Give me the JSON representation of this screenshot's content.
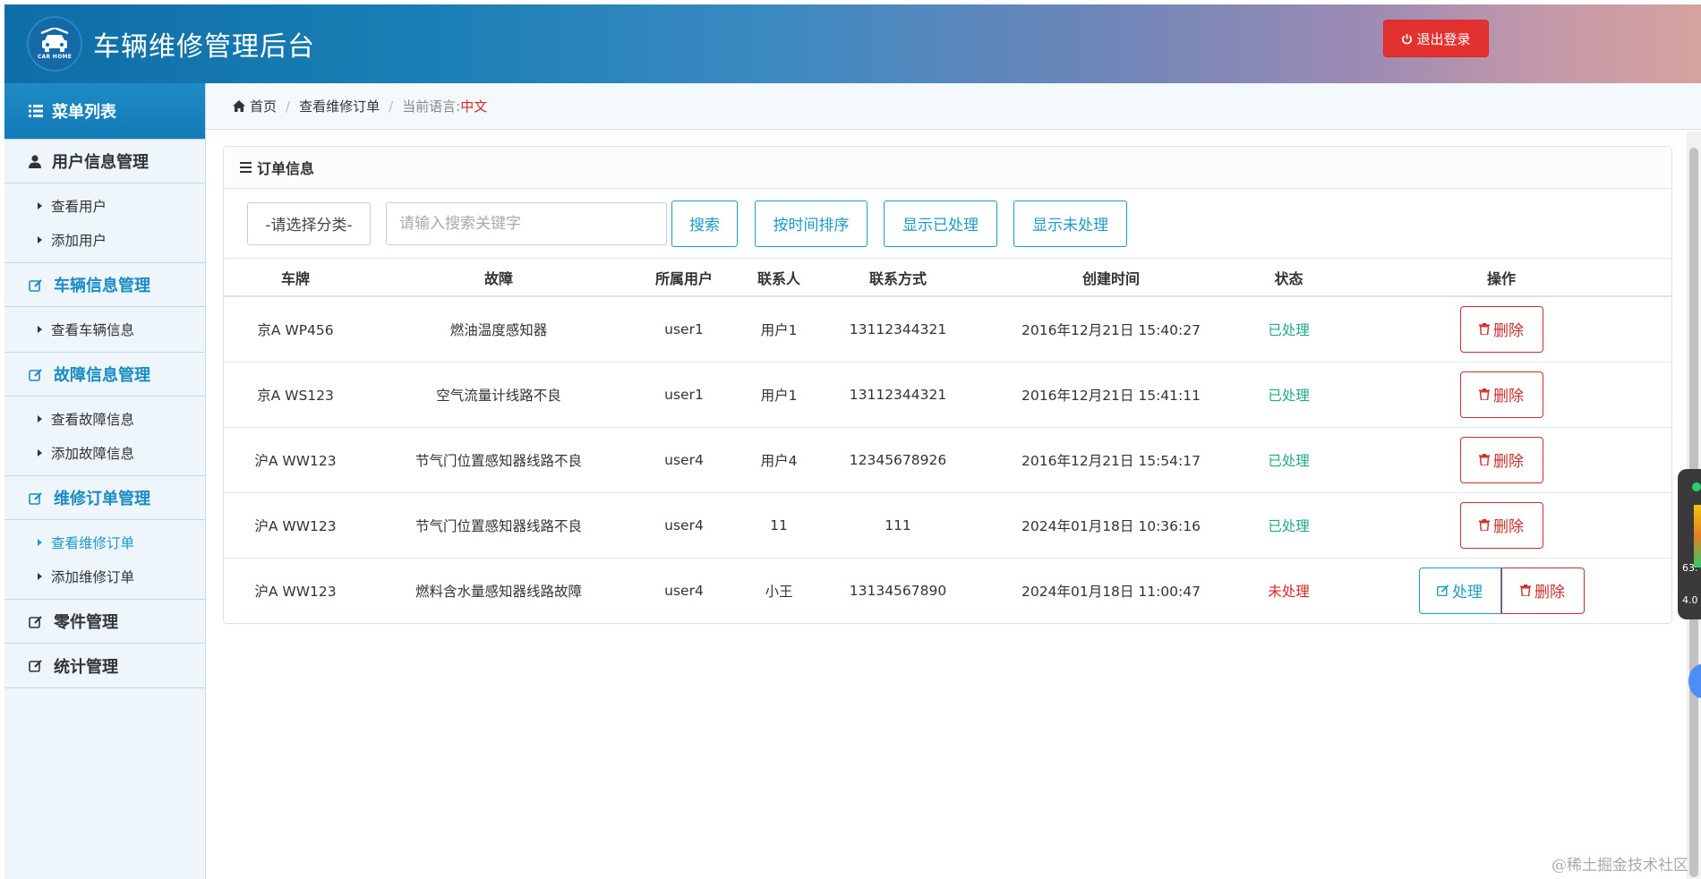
{
  "header": {
    "title": "车辆维修管理后台",
    "logo_text": "CAR HOME",
    "logout_label": "退出登录"
  },
  "sidebar": {
    "menu_title": "菜单列表",
    "groups": [
      {
        "label": "用户信息管理",
        "items": [
          "查看用户",
          "添加用户"
        ]
      },
      {
        "label": "车辆信息管理",
        "items": [
          "查看车辆信息"
        ]
      },
      {
        "label": "故障信息管理",
        "items": [
          "查看故障信息",
          "添加故障信息"
        ]
      },
      {
        "label": "维修订单管理",
        "items": [
          "查看维修订单",
          "添加维修订单"
        ]
      },
      {
        "label": "零件管理",
        "items": []
      },
      {
        "label": "统计管理",
        "items": []
      }
    ]
  },
  "breadcrumb": {
    "home": "首页",
    "current": "查看维修订单",
    "language_label": "当前语言:",
    "language_value": "中文"
  },
  "panel": {
    "title": "订单信息",
    "category_select": "-请选择分类-",
    "search_placeholder": "请输入搜索关键字",
    "search_btn": "搜索",
    "sort_btn": "按时间排序",
    "show_done_btn": "显示已处理",
    "show_todo_btn": "显示未处理"
  },
  "table": {
    "columns": [
      "车牌",
      "故障",
      "所属用户",
      "联系人",
      "联系方式",
      "创建时间",
      "状态",
      "操作"
    ],
    "rows": [
      {
        "plate": "京A WP456",
        "fault": "燃油温度感知器",
        "user": "user1",
        "contact": "用户1",
        "phone": "13112344321",
        "created": "2016年12月21日 15:40:27",
        "status": "已处理",
        "done": true
      },
      {
        "plate": "京A WS123",
        "fault": "空气流量计线路不良",
        "user": "user1",
        "contact": "用户1",
        "phone": "13112344321",
        "created": "2016年12月21日 15:41:11",
        "status": "已处理",
        "done": true
      },
      {
        "plate": "沪A WW123",
        "fault": "节气门位置感知器线路不良",
        "user": "user4",
        "contact": "用户4",
        "phone": "12345678926",
        "created": "2016年12月21日 15:54:17",
        "status": "已处理",
        "done": true
      },
      {
        "plate": "沪A WW123",
        "fault": "节气门位置感知器线路不良",
        "user": "user4",
        "contact": "11",
        "phone": "111",
        "created": "2024年01月18日 10:36:16",
        "status": "已处理",
        "done": true
      },
      {
        "plate": "沪A WW123",
        "fault": "燃料含水量感知器线路故障",
        "user": "user4",
        "contact": "小王",
        "phone": "13134567890",
        "created": "2024年01月18日 11:00:47",
        "status": "未处理",
        "done": false
      }
    ],
    "delete_label": "删除",
    "process_label": "处理"
  },
  "widget": {
    "value1": "63.",
    "value2": "4.0"
  },
  "watermark": "@稀土掘金技术社区",
  "colors": {
    "primary": "#1b9bc9",
    "danger": "#c9302c",
    "logout": "#e3312f",
    "done": "#1faa8a",
    "todo": "#d9281f"
  }
}
